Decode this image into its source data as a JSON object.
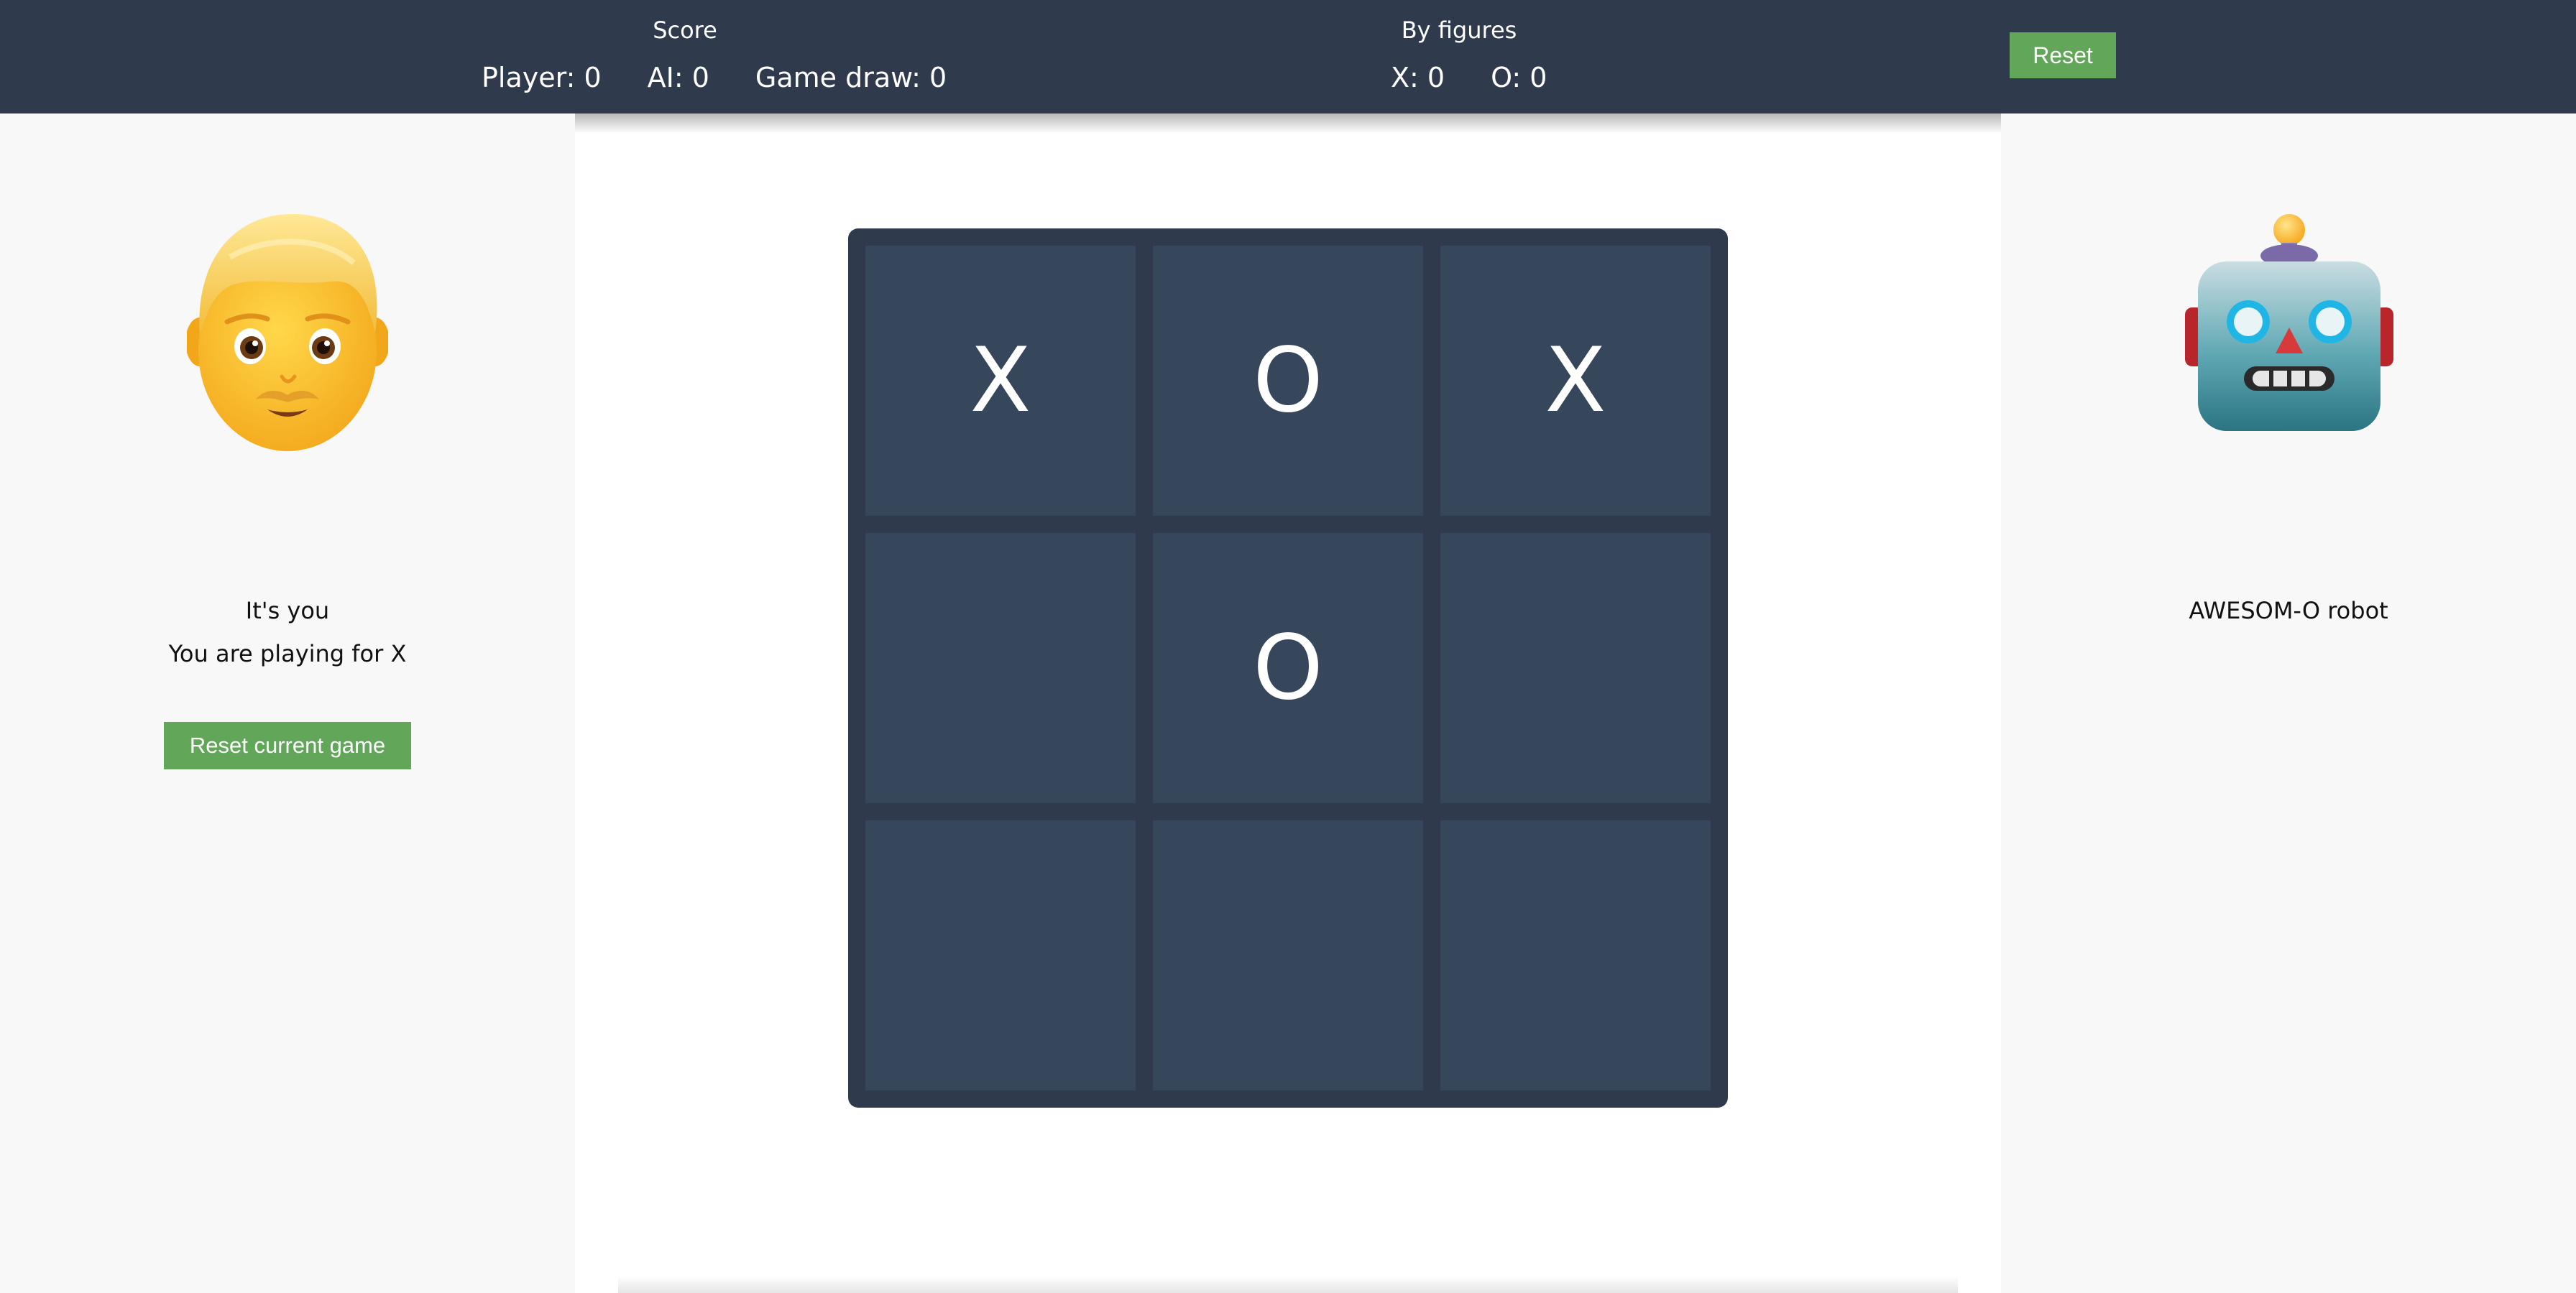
{
  "header": {
    "score_title": "Score",
    "player_score": "Player: 0",
    "ai_score": "AI: 0",
    "draw_score": "Game draw: 0",
    "figures_title": "By figures",
    "x_count": "X: 0",
    "o_count": "O: 0",
    "reset_label": "Reset"
  },
  "board": {
    "cells": [
      "X",
      "O",
      "X",
      "",
      "O",
      "",
      "",
      "",
      ""
    ]
  },
  "player": {
    "avatar_icon": "man-face-icon",
    "label": "It's you",
    "playing_for": "You are playing for X",
    "reset_game_label": "Reset current game"
  },
  "ai": {
    "avatar_icon": "robot-face-icon",
    "name": "AWESOM-O robot"
  },
  "colors": {
    "header_bg": "#2f3b4c",
    "board_bg": "#2f3b4c",
    "cell_bg": "#37475b",
    "button_green": "#62a65a",
    "page_bg": "#f8f8f8"
  }
}
